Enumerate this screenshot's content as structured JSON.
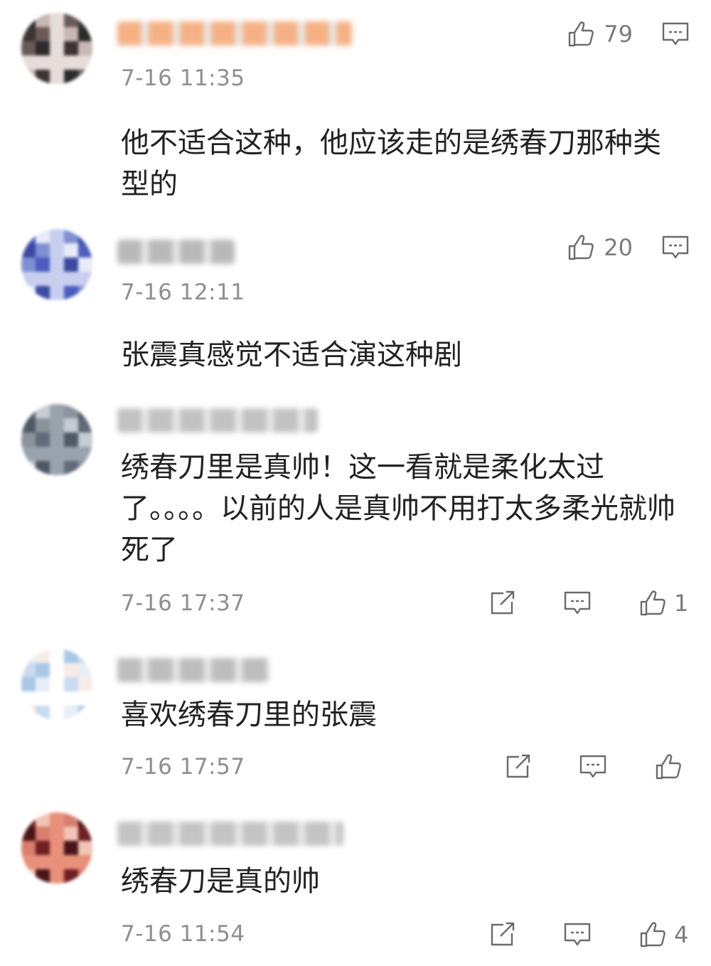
{
  "comments": [
    {
      "time": "7-16 11:35",
      "text": "他不适合这种，他应该走的是绣春刀那种类型的",
      "likes": "79",
      "colors": {
        "avatar": [
          "#2b2b2b",
          "#6a5b58",
          "#c9b7b3",
          "#3d3333",
          "#e6dcda"
        ],
        "name": "#f5b184"
      }
    },
    {
      "time": "7-16 12:11",
      "text": "张震真感觉不适合演这种剧",
      "likes": "20",
      "colors": {
        "avatar": [
          "#4c5cc0",
          "#7f8fd4",
          "#e9ecf7",
          "#3d4aa4",
          "#c8cfee"
        ],
        "name": "#b9b9b9"
      }
    },
    {
      "time": "7-16 17:37",
      "text": "绣春刀里是真帅！这一看就是柔化太过了。。。。以前的人是真帅不用打太多柔光就帅死了",
      "likes": "1",
      "colors": {
        "avatar": [
          "#5f6b78",
          "#8b939c",
          "#c6ccd2",
          "#4f5964",
          "#9aa3ad"
        ],
        "name": "#c2c2c2"
      }
    },
    {
      "time": "7-16 17:57",
      "text": "喜欢绣春刀里的张震",
      "likes": "",
      "colors": {
        "avatar": [
          "#e6eef6",
          "#a9c8e6",
          "#f7ece8",
          "#c9dbef",
          "#ffffff"
        ],
        "name": "#bdbdbd"
      }
    },
    {
      "time": "7-16 11:54",
      "text": "绣春刀是真的帅",
      "likes": "4",
      "colors": {
        "avatar": [
          "#6e1f22",
          "#d97d6e",
          "#f1c4b6",
          "#4a1518",
          "#e8907a"
        ],
        "name": "#c4c4c4"
      }
    }
  ]
}
